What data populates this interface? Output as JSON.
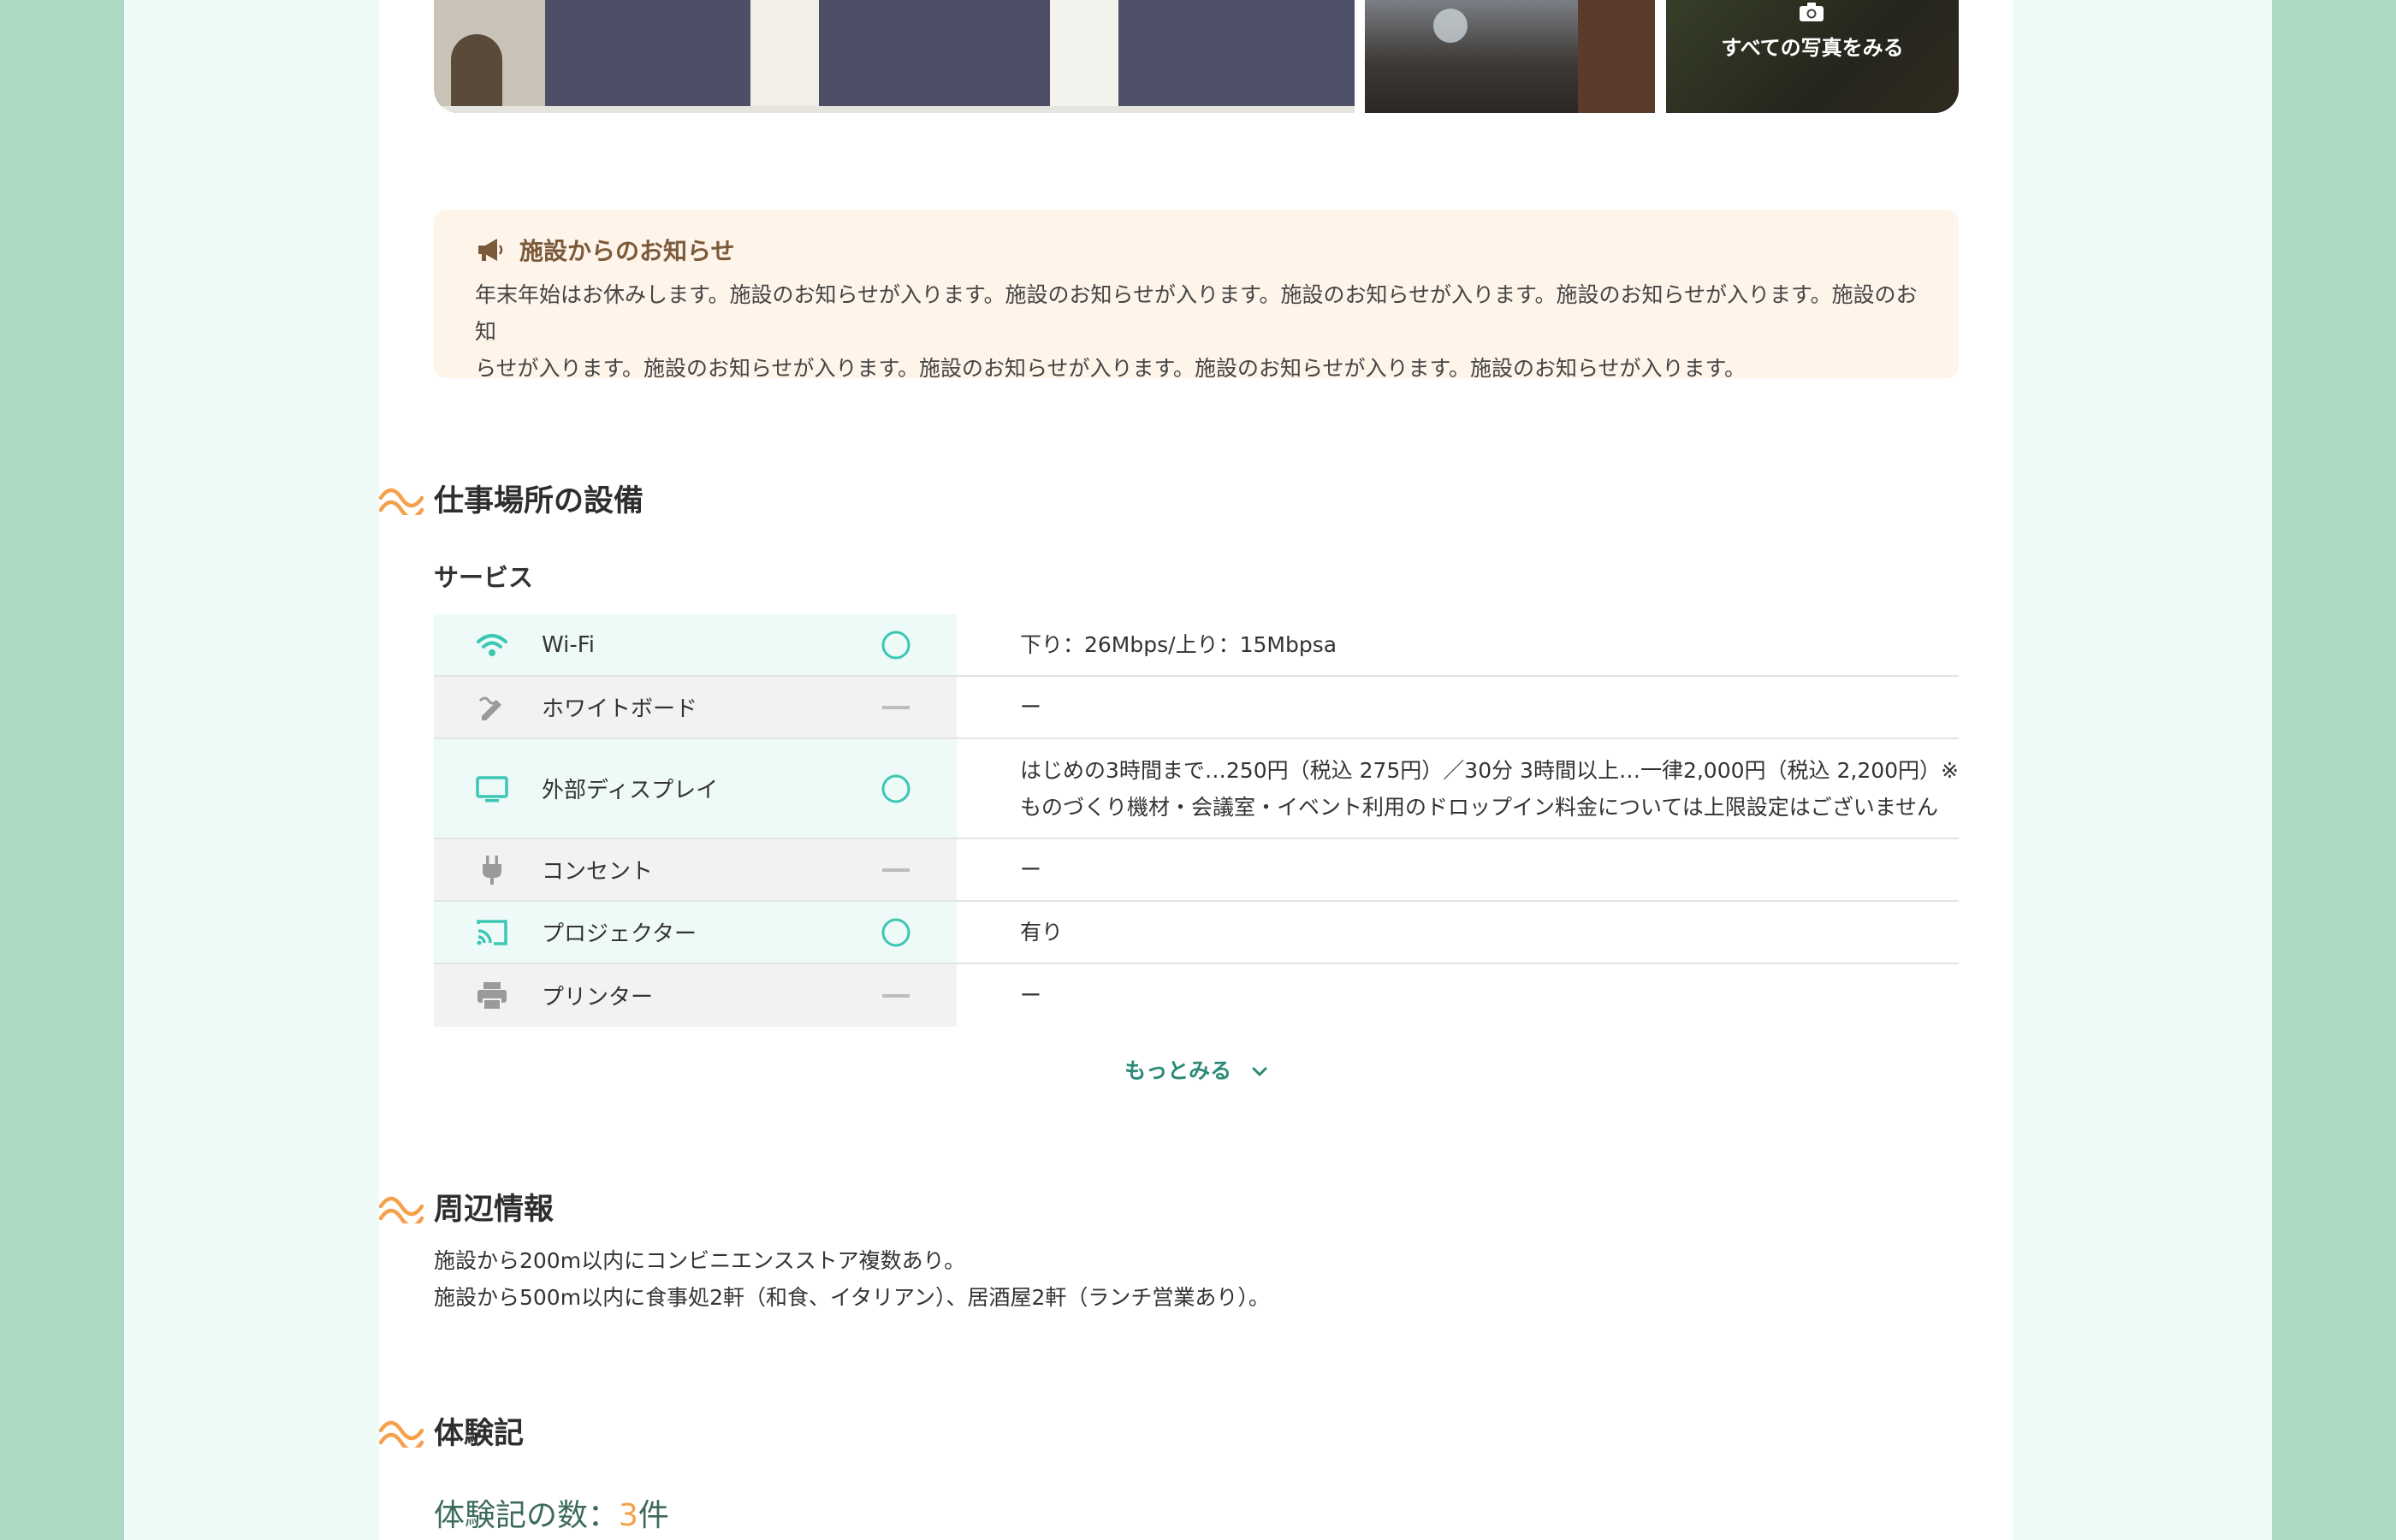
{
  "gallery": {
    "all_photos_label": "すべての写真をみる"
  },
  "notice": {
    "title": "施設からのお知らせ",
    "line1": "年末年始はお休みします。施設のお知らせが入ります。施設のお知らせが入ります。施設のお知らせが入ります。施設のお知らせが入ります。施設のお知",
    "line2": "らせが入ります。施設のお知らせが入ります。施設のお知らせが入ります。施設のお知らせが入ります。施設のお知らせが入ります。"
  },
  "facilities": {
    "heading": "仕事場所の設備",
    "subheading": "サービス",
    "rows": [
      {
        "icon": "wifi-icon",
        "name": "Wi-Fi",
        "available": true,
        "detail": "下り：26Mbps/上り：15Mbpsa",
        "detail2": ""
      },
      {
        "icon": "whiteboard-icon",
        "name": "ホワイトボード",
        "available": false,
        "detail": "ー",
        "detail2": ""
      },
      {
        "icon": "display-icon",
        "name": "外部ディスプレイ",
        "available": true,
        "detail": "はじめの3時間まで…250円（税込 275円）／30分 3時間以上…一律2,000円（税込 2,200円）※",
        "detail2": "ものづくり機材・会議室・イベント利用のドロップイン料金については上限設定はございません"
      },
      {
        "icon": "outlet-icon",
        "name": "コンセント",
        "available": false,
        "detail": "ー",
        "detail2": ""
      },
      {
        "icon": "projector-icon",
        "name": "プロジェクター",
        "available": true,
        "detail": "有り",
        "detail2": ""
      },
      {
        "icon": "printer-icon",
        "name": "プリンター",
        "available": false,
        "detail": "ー",
        "detail2": ""
      }
    ],
    "more_label": "もっとみる"
  },
  "area": {
    "heading": "周辺情報",
    "line1": "施設から200m以内にコンビニエンスストア複数あり。",
    "line2": "施設から500m以内に食事処2軒（和食、イタリアン）、居酒屋2軒（ランチ営業あり）。"
  },
  "reports": {
    "heading": "体験記",
    "count_label": "体験記の数：",
    "count_value": "3",
    "count_unit": "件"
  },
  "colors": {
    "accent_teal": "#3cc7b4",
    "accent_orange": "#f5a04a",
    "notice_bg": "#fff4ea",
    "page_bg": "#acd9c2"
  }
}
